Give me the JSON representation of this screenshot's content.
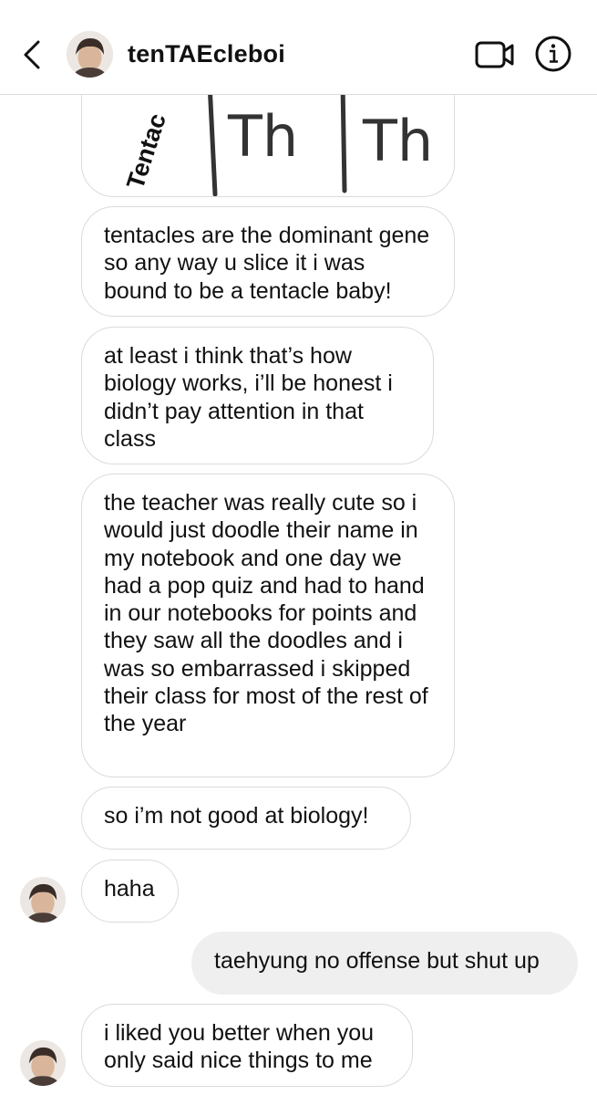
{
  "header": {
    "username": "tenTAEcleboi",
    "back_icon": "chevron-left-icon",
    "video_icon": "video-camera-icon",
    "info_icon": "info-icon"
  },
  "image_message": {
    "tentacle_text": "Tentac",
    "th_1": "Th",
    "th_2": "Th"
  },
  "messages": [
    {
      "from": "them",
      "text": "tentacles are the dominant gene so any way u slice it i was bound to be a tentacle baby!"
    },
    {
      "from": "them",
      "text": "at least i think that’s how biology works, i’ll be honest i didn’t pay attention in that class"
    },
    {
      "from": "them",
      "text": "the teacher was really cute so i would just doodle their name in my notebook and one day we had a pop quiz and had to hand in our notebooks for points and they saw all the doodles and i was so embarrassed i skipped their class for most of the rest of the year"
    },
    {
      "from": "them",
      "text": "so i’m not good at biology!"
    },
    {
      "from": "them",
      "text": "haha"
    },
    {
      "from": "me",
      "text": "taehyung no offense but shut up"
    },
    {
      "from": "them",
      "text": "i liked you better when you only said nice things to me"
    }
  ]
}
